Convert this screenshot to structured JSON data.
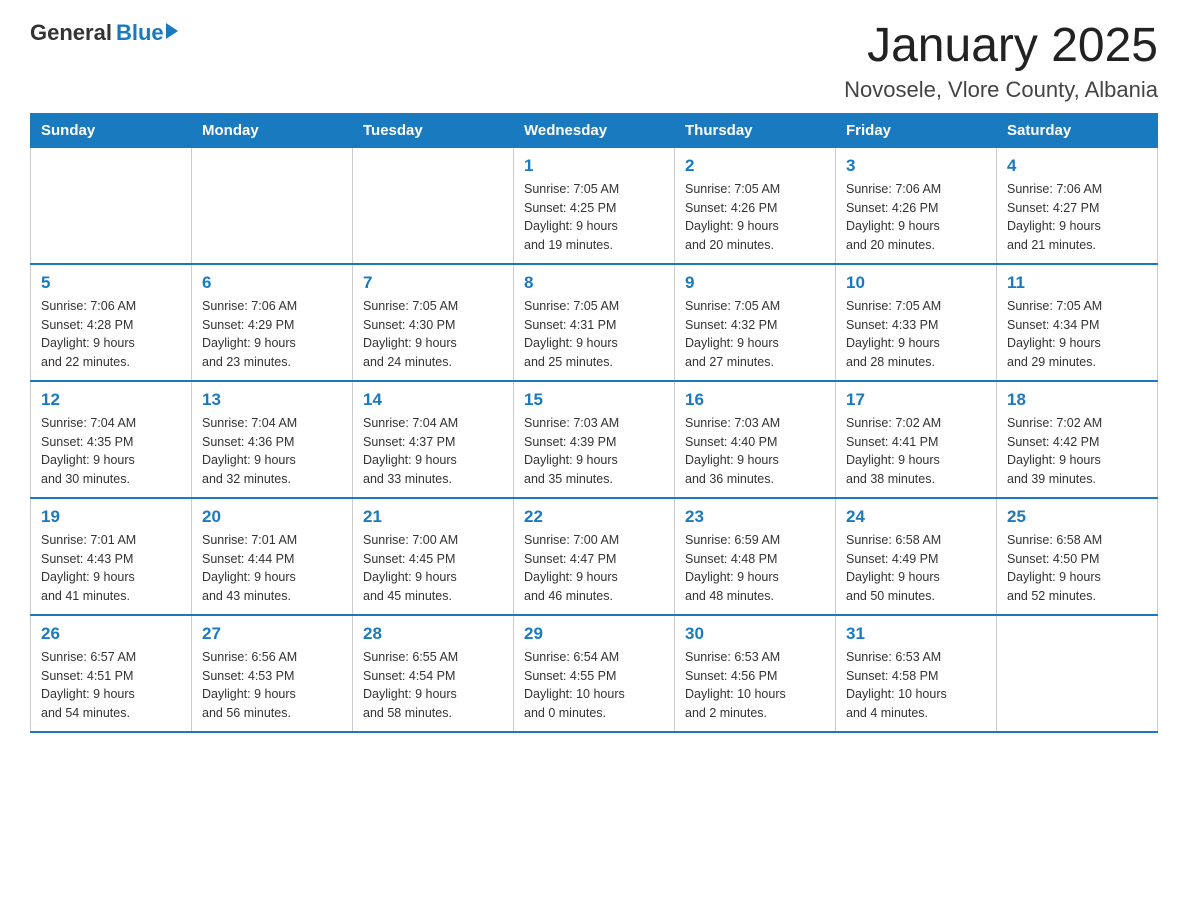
{
  "header": {
    "logo_general": "General",
    "logo_blue": "Blue",
    "title": "January 2025",
    "subtitle": "Novosele, Vlore County, Albania"
  },
  "days_of_week": [
    "Sunday",
    "Monday",
    "Tuesday",
    "Wednesday",
    "Thursday",
    "Friday",
    "Saturday"
  ],
  "weeks": [
    [
      {
        "day": "",
        "info": ""
      },
      {
        "day": "",
        "info": ""
      },
      {
        "day": "",
        "info": ""
      },
      {
        "day": "1",
        "info": "Sunrise: 7:05 AM\nSunset: 4:25 PM\nDaylight: 9 hours\nand 19 minutes."
      },
      {
        "day": "2",
        "info": "Sunrise: 7:05 AM\nSunset: 4:26 PM\nDaylight: 9 hours\nand 20 minutes."
      },
      {
        "day": "3",
        "info": "Sunrise: 7:06 AM\nSunset: 4:26 PM\nDaylight: 9 hours\nand 20 minutes."
      },
      {
        "day": "4",
        "info": "Sunrise: 7:06 AM\nSunset: 4:27 PM\nDaylight: 9 hours\nand 21 minutes."
      }
    ],
    [
      {
        "day": "5",
        "info": "Sunrise: 7:06 AM\nSunset: 4:28 PM\nDaylight: 9 hours\nand 22 minutes."
      },
      {
        "day": "6",
        "info": "Sunrise: 7:06 AM\nSunset: 4:29 PM\nDaylight: 9 hours\nand 23 minutes."
      },
      {
        "day": "7",
        "info": "Sunrise: 7:05 AM\nSunset: 4:30 PM\nDaylight: 9 hours\nand 24 minutes."
      },
      {
        "day": "8",
        "info": "Sunrise: 7:05 AM\nSunset: 4:31 PM\nDaylight: 9 hours\nand 25 minutes."
      },
      {
        "day": "9",
        "info": "Sunrise: 7:05 AM\nSunset: 4:32 PM\nDaylight: 9 hours\nand 27 minutes."
      },
      {
        "day": "10",
        "info": "Sunrise: 7:05 AM\nSunset: 4:33 PM\nDaylight: 9 hours\nand 28 minutes."
      },
      {
        "day": "11",
        "info": "Sunrise: 7:05 AM\nSunset: 4:34 PM\nDaylight: 9 hours\nand 29 minutes."
      }
    ],
    [
      {
        "day": "12",
        "info": "Sunrise: 7:04 AM\nSunset: 4:35 PM\nDaylight: 9 hours\nand 30 minutes."
      },
      {
        "day": "13",
        "info": "Sunrise: 7:04 AM\nSunset: 4:36 PM\nDaylight: 9 hours\nand 32 minutes."
      },
      {
        "day": "14",
        "info": "Sunrise: 7:04 AM\nSunset: 4:37 PM\nDaylight: 9 hours\nand 33 minutes."
      },
      {
        "day": "15",
        "info": "Sunrise: 7:03 AM\nSunset: 4:39 PM\nDaylight: 9 hours\nand 35 minutes."
      },
      {
        "day": "16",
        "info": "Sunrise: 7:03 AM\nSunset: 4:40 PM\nDaylight: 9 hours\nand 36 minutes."
      },
      {
        "day": "17",
        "info": "Sunrise: 7:02 AM\nSunset: 4:41 PM\nDaylight: 9 hours\nand 38 minutes."
      },
      {
        "day": "18",
        "info": "Sunrise: 7:02 AM\nSunset: 4:42 PM\nDaylight: 9 hours\nand 39 minutes."
      }
    ],
    [
      {
        "day": "19",
        "info": "Sunrise: 7:01 AM\nSunset: 4:43 PM\nDaylight: 9 hours\nand 41 minutes."
      },
      {
        "day": "20",
        "info": "Sunrise: 7:01 AM\nSunset: 4:44 PM\nDaylight: 9 hours\nand 43 minutes."
      },
      {
        "day": "21",
        "info": "Sunrise: 7:00 AM\nSunset: 4:45 PM\nDaylight: 9 hours\nand 45 minutes."
      },
      {
        "day": "22",
        "info": "Sunrise: 7:00 AM\nSunset: 4:47 PM\nDaylight: 9 hours\nand 46 minutes."
      },
      {
        "day": "23",
        "info": "Sunrise: 6:59 AM\nSunset: 4:48 PM\nDaylight: 9 hours\nand 48 minutes."
      },
      {
        "day": "24",
        "info": "Sunrise: 6:58 AM\nSunset: 4:49 PM\nDaylight: 9 hours\nand 50 minutes."
      },
      {
        "day": "25",
        "info": "Sunrise: 6:58 AM\nSunset: 4:50 PM\nDaylight: 9 hours\nand 52 minutes."
      }
    ],
    [
      {
        "day": "26",
        "info": "Sunrise: 6:57 AM\nSunset: 4:51 PM\nDaylight: 9 hours\nand 54 minutes."
      },
      {
        "day": "27",
        "info": "Sunrise: 6:56 AM\nSunset: 4:53 PM\nDaylight: 9 hours\nand 56 minutes."
      },
      {
        "day": "28",
        "info": "Sunrise: 6:55 AM\nSunset: 4:54 PM\nDaylight: 9 hours\nand 58 minutes."
      },
      {
        "day": "29",
        "info": "Sunrise: 6:54 AM\nSunset: 4:55 PM\nDaylight: 10 hours\nand 0 minutes."
      },
      {
        "day": "30",
        "info": "Sunrise: 6:53 AM\nSunset: 4:56 PM\nDaylight: 10 hours\nand 2 minutes."
      },
      {
        "day": "31",
        "info": "Sunrise: 6:53 AM\nSunset: 4:58 PM\nDaylight: 10 hours\nand 4 minutes."
      },
      {
        "day": "",
        "info": ""
      }
    ]
  ]
}
